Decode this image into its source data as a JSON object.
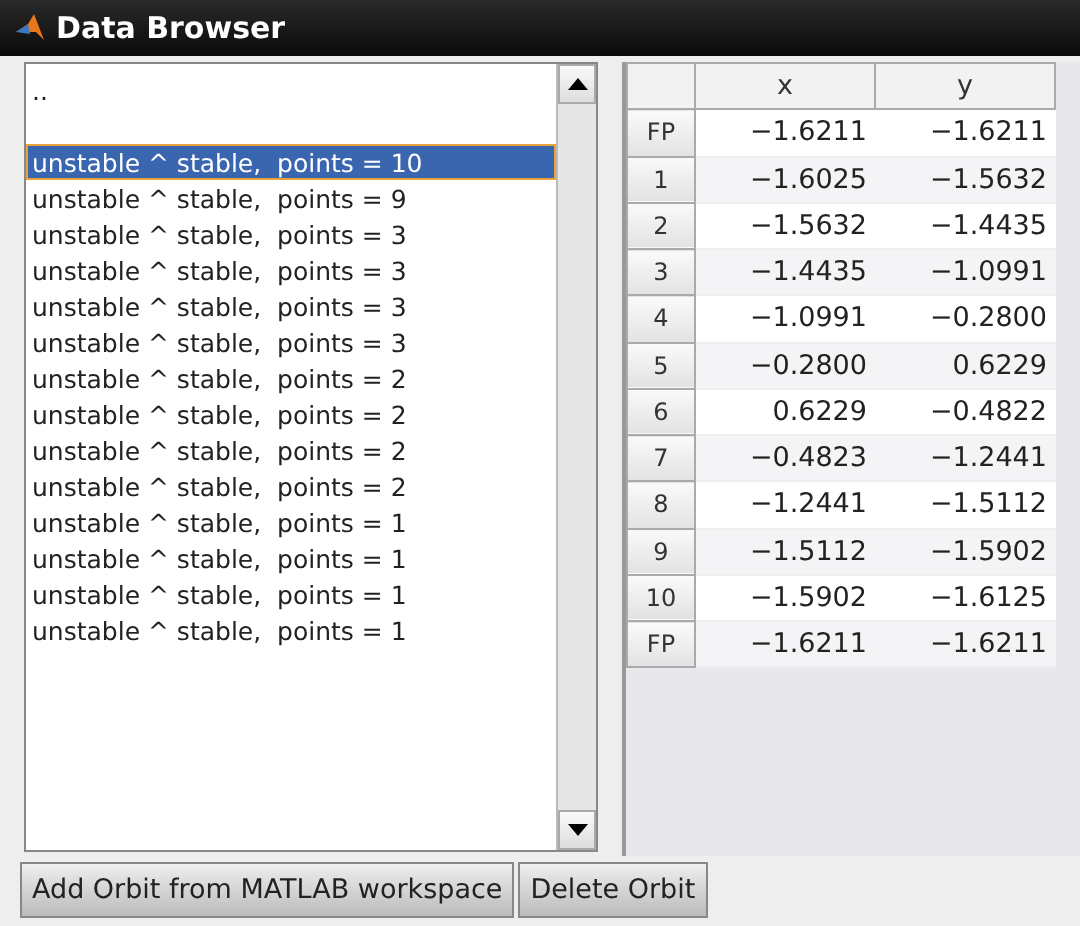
{
  "window": {
    "title": "Data Browser"
  },
  "orbit_list": {
    "items": [
      {
        "label": "..",
        "selected": false
      },
      {
        "selected": false
      },
      {
        "label": "unstable ^ stable,  points = 10",
        "selected": true
      },
      {
        "label": "unstable ^ stable,  points = 9",
        "selected": false
      },
      {
        "label": "unstable ^ stable,  points = 3",
        "selected": false
      },
      {
        "label": "unstable ^ stable,  points = 3",
        "selected": false
      },
      {
        "label": "unstable ^ stable,  points = 3",
        "selected": false
      },
      {
        "label": "unstable ^ stable,  points = 3",
        "selected": false
      },
      {
        "label": "unstable ^ stable,  points = 2",
        "selected": false
      },
      {
        "label": "unstable ^ stable,  points = 2",
        "selected": false
      },
      {
        "label": "unstable ^ stable,  points = 2",
        "selected": false
      },
      {
        "label": "unstable ^ stable,  points = 2",
        "selected": false
      },
      {
        "label": "unstable ^ stable,  points = 1",
        "selected": false
      },
      {
        "label": "unstable ^ stable,  points = 1",
        "selected": false
      },
      {
        "label": "unstable ^ stable,  points = 1",
        "selected": false
      },
      {
        "label": "unstable ^ stable,  points = 1",
        "selected": false
      }
    ]
  },
  "table": {
    "columns": [
      "x",
      "y"
    ],
    "rows": [
      {
        "header": "FP",
        "cells": [
          "−1.6211",
          "−1.6211"
        ]
      },
      {
        "header": "1",
        "cells": [
          "−1.6025",
          "−1.5632"
        ]
      },
      {
        "header": "2",
        "cells": [
          "−1.5632",
          "−1.4435"
        ]
      },
      {
        "header": "3",
        "cells": [
          "−1.4435",
          "−1.0991"
        ]
      },
      {
        "header": "4",
        "cells": [
          "−1.0991",
          "−0.2800"
        ]
      },
      {
        "header": "5",
        "cells": [
          "−0.2800",
          "0.6229"
        ]
      },
      {
        "header": "6",
        "cells": [
          "0.6229",
          "−0.4822"
        ]
      },
      {
        "header": "7",
        "cells": [
          "−0.4823",
          "−1.2441"
        ]
      },
      {
        "header": "8",
        "cells": [
          "−1.2441",
          "−1.5112"
        ]
      },
      {
        "header": "9",
        "cells": [
          "−1.5112",
          "−1.5902"
        ]
      },
      {
        "header": "10",
        "cells": [
          "−1.5902",
          "−1.6125"
        ]
      },
      {
        "header": "FP",
        "cells": [
          "−1.6211",
          "−1.6211"
        ]
      }
    ]
  },
  "buttons": [
    "Add Orbit from MATLAB workspace",
    "Delete Orbit"
  ]
}
